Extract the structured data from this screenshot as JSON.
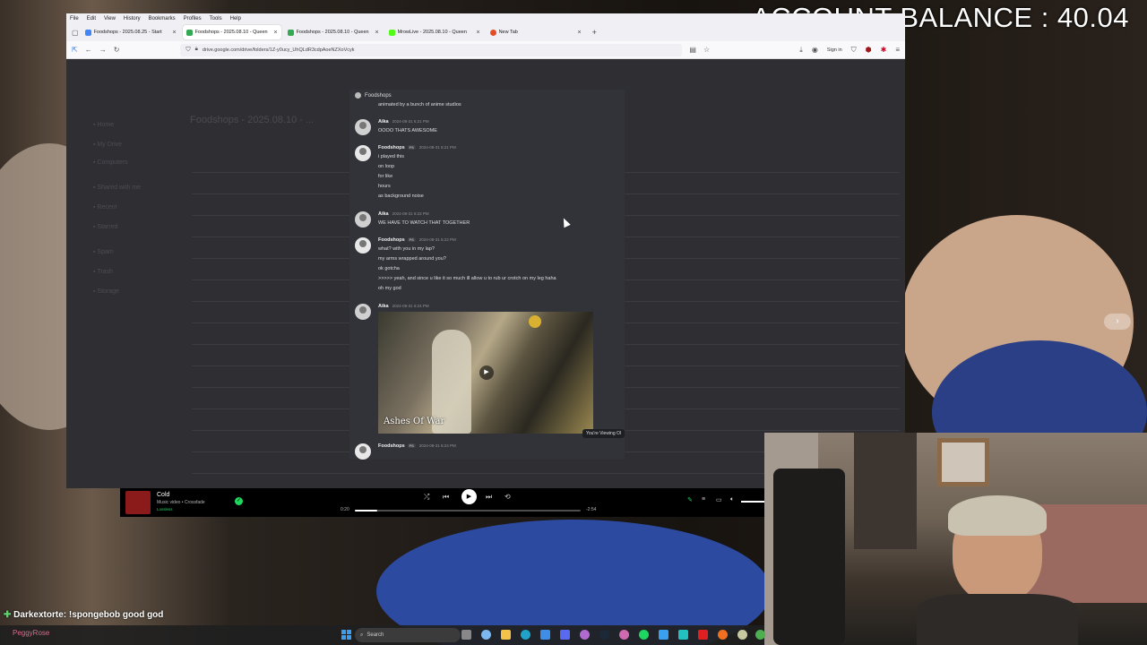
{
  "overlay": {
    "balance": "ACCOUNT BALANCE : 40.04"
  },
  "browser": {
    "menu": [
      "File",
      "Edit",
      "View",
      "History",
      "Bookmarks",
      "Profiles",
      "Tools",
      "Help"
    ],
    "tabs": [
      {
        "label": "Foodshops - 2025.08.25 - Start",
        "favicon_color": "#4285f4",
        "active": false
      },
      {
        "label": "Foodshops - 2025.08.10 - Queen",
        "favicon_color": "#34a853",
        "active": true
      },
      {
        "label": "Foodshops - 2025.08.10 - Queen",
        "favicon_color": "#34a853",
        "active": false
      },
      {
        "label": "MrowLive - 2025.08.10 - Queen",
        "favicon_color": "#53fc18",
        "active": false
      },
      {
        "label": "New Tab",
        "favicon_color": "#e34c26",
        "active": false
      }
    ],
    "url": "drive.google.com/drive/folders/1Z-y0ucy_UhQLdR3cdpAoeNZXoVcyk",
    "signin": "Sign in",
    "drive_title": "Foodshops - 2025.08.10 - ..."
  },
  "discord": {
    "channel": "Foodshops",
    "top_cut_line": "animated by a bunch of anime studios",
    "messages": [
      {
        "user": "Aika",
        "time": "2024-08-31 6:21 PM",
        "badge": "",
        "lines": [
          "OOOO THATS AWESOME"
        ]
      },
      {
        "user": "Foodshops",
        "time": "2024-08-31 6:21 PM",
        "badge": "FS",
        "lines": [
          "i played this",
          "on loop",
          "for like",
          "hours",
          "as background noise"
        ]
      },
      {
        "user": "Aika",
        "time": "2024-08-31 6:22 PM",
        "badge": "",
        "lines": [
          "WE HAVE TO WATCH THAT TOGETHER"
        ]
      },
      {
        "user": "Foodshops",
        "time": "2024-08-31 6:22 PM",
        "badge": "FS",
        "lines": [
          "what? with you in my lap?",
          "my arms wrapped around you?",
          "ok gotcha",
          ">>>>> yeah, and since u like it so much ill allow u to rub ur crotch on my leg haha",
          "oh my god"
        ]
      },
      {
        "user": "Aika",
        "time": "2024-08-31 6:24 PM",
        "badge": "",
        "lines": []
      },
      {
        "user": "Foodshops",
        "time": "2024-08-31 6:24 PM",
        "badge": "FS",
        "lines": []
      }
    ],
    "media_title": "Ashes Of War",
    "viewing_notice": "You're Viewing Ol"
  },
  "player": {
    "track": "Cold",
    "subtitle": "Music video • Crossfade",
    "quality": "Lossless",
    "elapsed": "0:20",
    "remaining": "-2:54",
    "progress": 0.1
  },
  "chat": {
    "user": "Darkextorte",
    "message": ": !spongebob good god"
  },
  "taskbar": {
    "search_placeholder": "Search",
    "stream_user": "PeggyRose"
  }
}
